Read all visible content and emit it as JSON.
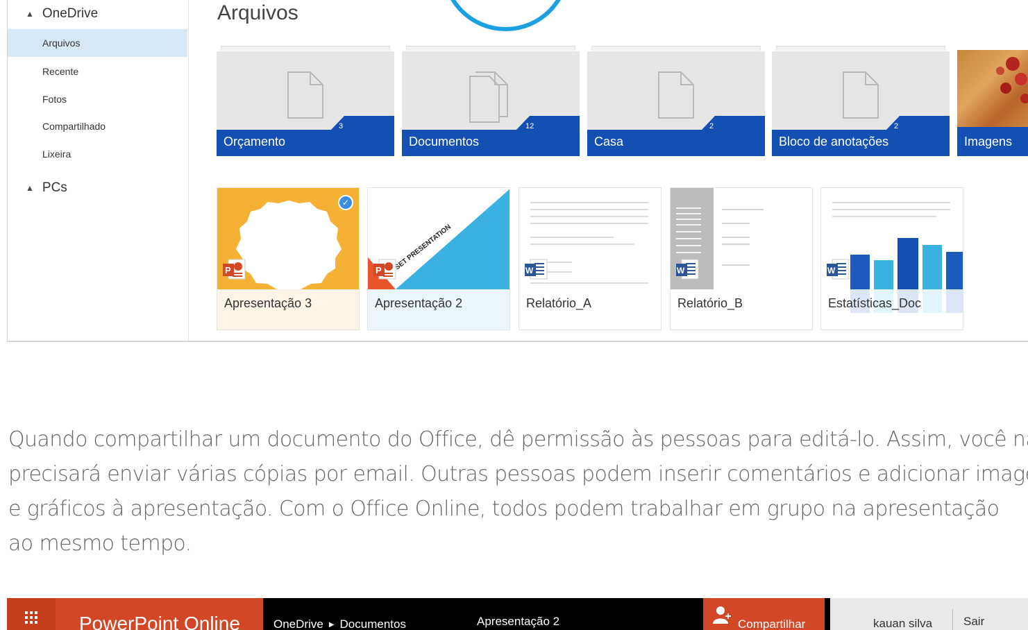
{
  "sidebar": {
    "group_onedrive": "OneDrive",
    "items": [
      {
        "label": "Arquivos"
      },
      {
        "label": "Recente"
      },
      {
        "label": "Fotos"
      },
      {
        "label": "Compartilhado"
      },
      {
        "label": "Lixeira"
      }
    ],
    "group_pcs": "PCs"
  },
  "main": {
    "title": "Arquivos",
    "folders": [
      {
        "name": "Orçamento",
        "count": "3"
      },
      {
        "name": "Documentos",
        "count": "12"
      },
      {
        "name": "Casa",
        "count": "2"
      },
      {
        "name": "Bloco de anotações",
        "count": "2"
      },
      {
        "name": "Imagens"
      }
    ],
    "files": [
      {
        "name": "Apresentação 3",
        "type": "powerpoint-icon"
      },
      {
        "name": "Apresentação 2",
        "type": "powerpoint-icon",
        "slide_text": "SET PRESENTATION"
      },
      {
        "name": "Relatório_A",
        "type": "word-icon"
      },
      {
        "name": "Relatório_B",
        "type": "word-icon"
      },
      {
        "name": "Estatísticas_Doc",
        "type": "word-icon"
      }
    ]
  },
  "description": {
    "line1": "Quando compartilhar um documento do Office, dê permissão às pessoas para editá-lo. Assim, você não",
    "line2": "precisará enviar várias cópias por email. Outras pessoas podem inserir comentários e adicionar imagens",
    "line3": "e gráficos à apresentação. Com o Office Online, todos podem trabalhar em grupo na apresentação",
    "line4": "ao mesmo tempo."
  },
  "appbar": {
    "app_name": "PowerPoint Online",
    "breadcrumb_root": "OneDrive",
    "breadcrumb_folder": "Documentos",
    "doc_title": "Apresentação 2",
    "share_label": "Compartilhar",
    "user_name": "kauan silva",
    "signout_label": "Sair"
  },
  "colors": {
    "folder_band": "#1450b4",
    "powerpoint_accent": "#d24726",
    "selected_nav": "#d7e8f6",
    "circle_accent": "#1ba1e2"
  }
}
